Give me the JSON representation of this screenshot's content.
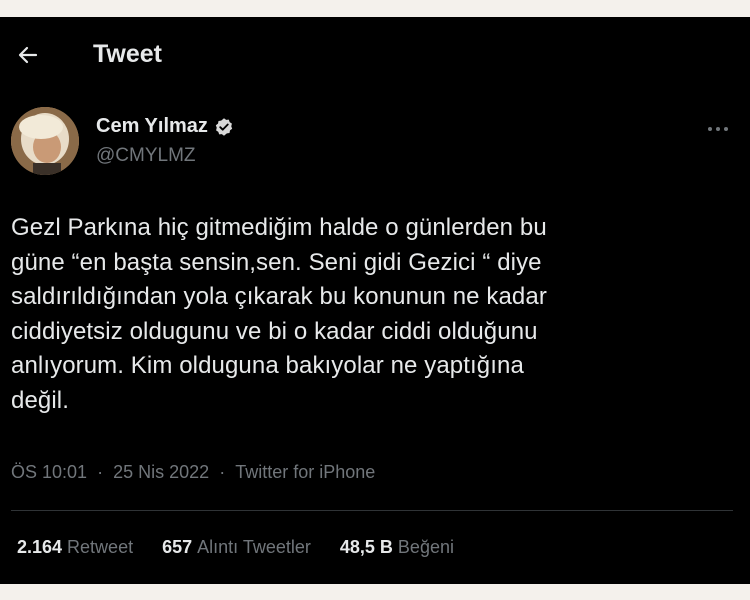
{
  "header": {
    "title": "Tweet"
  },
  "author": {
    "display_name": "Cem Yılmaz",
    "handle": "@CMYLMZ",
    "verified": true
  },
  "tweet": {
    "text": "Gezl Parkına hiç gitmediğim halde o günlerden bu\ngüne  “en başta sensin,sen. Seni gidi Gezici “ diye\nsaldırıldığından yola çıkarak  bu konunun ne kadar\nciddiyetsiz oldugunu ve bi o kadar ciddi olduğunu\nanlıyorum. Kim olduguna bakıyolar ne yaptığına\ndeğil.",
    "time": "ÖS 10:01",
    "separator": "·",
    "date": "25 Nis 2022",
    "source": "Twitter for iPhone"
  },
  "stats": {
    "retweets_count": "2.164",
    "retweets_label": "Retweet",
    "quotes_count": "657",
    "quotes_label": "Alıntı Tweetler",
    "likes_count": "48,5 B",
    "likes_label": "Beğeni"
  },
  "colors": {
    "background": "#000000",
    "text": "#e7e9ea",
    "muted": "#71767b",
    "verified_badge": "#d9d9d9",
    "page_border": "#f4f1ec"
  },
  "icons": {
    "back": "arrow-left-icon",
    "verified": "verified-badge-icon",
    "more": "more-horizontal-icon"
  }
}
